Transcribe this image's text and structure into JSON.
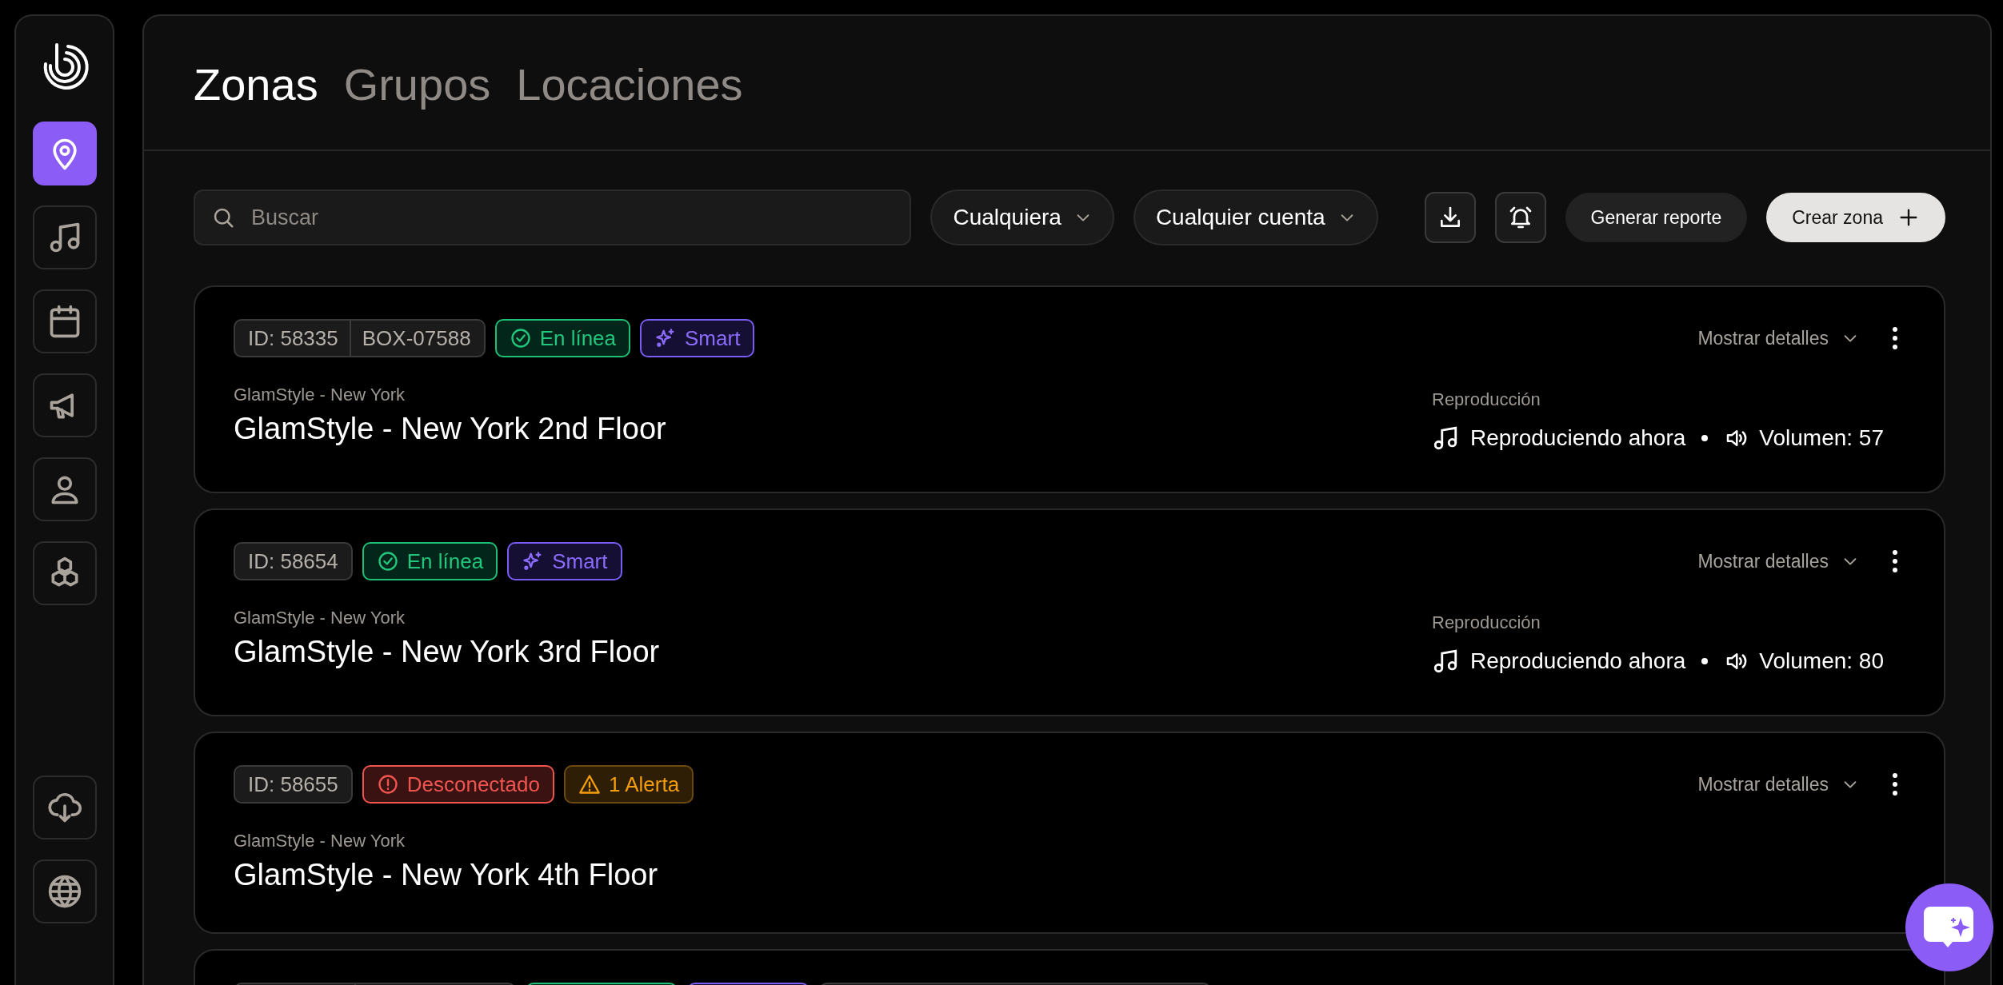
{
  "sidebar": {
    "top_items": [
      {
        "selected": true
      },
      {
        "selected": false
      },
      {
        "selected": false
      },
      {
        "selected": false
      },
      {
        "selected": false
      },
      {
        "selected": false
      }
    ],
    "bottom_items": [
      {
        "selected": false
      },
      {
        "selected": false
      }
    ]
  },
  "tabs": [
    {
      "label": "Zonas",
      "selected": true
    },
    {
      "label": "Grupos",
      "selected": false
    },
    {
      "label": "Locaciones",
      "selected": false
    }
  ],
  "toolbar": {
    "search": {
      "placeholder": "Buscar"
    },
    "filters": [
      "Cualquiera",
      "Cualquier cuenta"
    ],
    "report_button": "Generar reporte",
    "create_button": "Crear zona"
  },
  "zones": [
    {
      "badges": [
        {
          "kind": "id",
          "text": "ID: 58335",
          "secondary": "BOX-07588"
        },
        {
          "kind": "online",
          "text": "En línea"
        },
        {
          "kind": "smart",
          "text": "Smart"
        }
      ],
      "details_button": "Mostrar detalles",
      "account": "GlamStyle - New York",
      "name": "GlamStyle - New York 2nd Floor",
      "playback": {
        "label": "Reproducción",
        "status": "Reproduciendo ahora",
        "volume": "Volumen: 57"
      }
    },
    {
      "badges": [
        {
          "kind": "id",
          "text": "ID: 58654"
        },
        {
          "kind": "online",
          "text": "En línea"
        },
        {
          "kind": "smart",
          "text": "Smart"
        }
      ],
      "details_button": "Mostrar detalles",
      "account": "GlamStyle - New York",
      "name": "GlamStyle - New York 3rd Floor",
      "playback": {
        "label": "Reproducción",
        "status": "Reproduciendo ahora",
        "volume": "Volumen: 80"
      }
    },
    {
      "badges": [
        {
          "kind": "id",
          "text": "ID: 58655"
        },
        {
          "kind": "offline",
          "text": "Desconectado"
        },
        {
          "kind": "alert",
          "text": "1 Alerta"
        }
      ],
      "details_button": "Mostrar detalles",
      "account": "GlamStyle - New York",
      "name": "GlamStyle - New York 4th Floor"
    },
    {
      "badges": [
        {
          "kind": "id-split"
        },
        {
          "kind": "online"
        },
        {
          "kind": "smart"
        },
        {
          "kind": "tag"
        }
      ]
    }
  ]
}
